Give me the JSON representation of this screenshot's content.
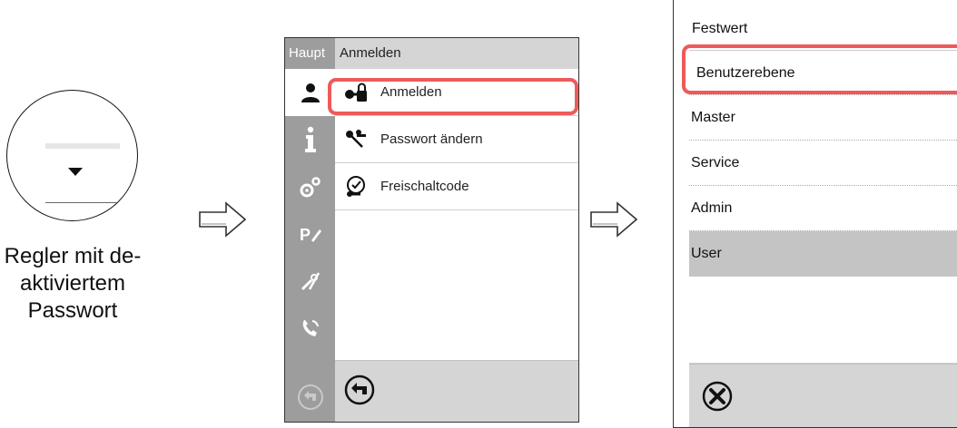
{
  "knob": {
    "caption_lines": [
      "Regler mit de-",
      "aktiviertem",
      "Passwort"
    ]
  },
  "device": {
    "sidebar_title": "Haupt",
    "header_title": "Anmelden",
    "sidebar_icons": [
      "user-icon",
      "info-icon",
      "settings-gears-icon",
      "program-edit-icon",
      "service-tools-icon",
      "phone-service-icon",
      "back-disabled-icon"
    ],
    "menu": [
      {
        "label": "Anmelden",
        "icon": "login-lock-icon"
      },
      {
        "label": "Passwort ändern",
        "icon": "change-password-keys-icon"
      },
      {
        "label": "Freischaltcode",
        "icon": "unlock-code-icon"
      }
    ],
    "highlight_color": "#ee5a5a"
  },
  "dialog": {
    "title": "Festwert",
    "options": [
      {
        "label": "Benutzerebene",
        "selected": false
      },
      {
        "label": "Master",
        "selected": false
      },
      {
        "label": "Service",
        "selected": false
      },
      {
        "label": "Admin",
        "selected": false
      },
      {
        "label": "User",
        "selected": true
      }
    ],
    "cancel_icon": "cancel-circle-x-icon",
    "highlight_color": "#ee5a5a"
  }
}
